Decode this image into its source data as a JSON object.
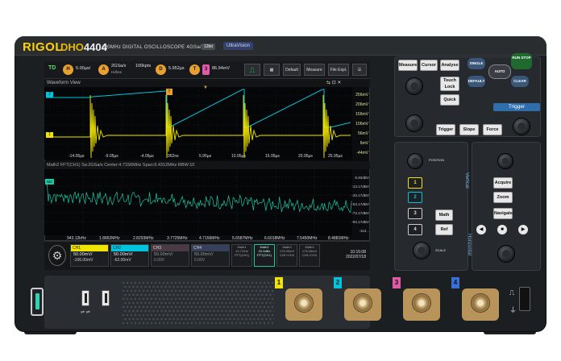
{
  "header": {
    "brand": "RIGOL",
    "model_prefix": "DHO",
    "model_number": "4404",
    "spec": "400MHz   DIGITAL OSCILLOSCOPE  4GSa/s",
    "bit_badge": "12bit",
    "ultra_badge": "UltraVision"
  },
  "statusbar": {
    "run_state": "TD",
    "h_label": "H",
    "h_value": "5.00µs/",
    "a_label": "A",
    "a_rate": "2GSa/s",
    "a_points": "100kpts",
    "d_label": "D",
    "d_value": "5.952µs",
    "t_label": "T",
    "t_channel": "3",
    "t_value": "86.94mV",
    "default_label": "Default",
    "measure_label": "Measure",
    "file_label": "File Expl."
  },
  "waveform": {
    "title": "Waveform View",
    "y_labels": [
      "256mV",
      "206mV",
      "156mV",
      "106mV",
      "56mV",
      "6mV",
      "-44mV"
    ],
    "x_labels": [
      "-14.05µs",
      "-9.05µs",
      "-4.05µs",
      "952ns",
      "5.95µs",
      "10.95µs",
      "15.95µs",
      "20.95µs",
      "25.95µs"
    ],
    "marker_ch1": "1",
    "marker_ch2": "2",
    "trigger_marker": "T"
  },
  "fft": {
    "title": "Math2   FFT(CH1)   Sa:2GSa/s    Center:4.7156MHz      Span:9.4312MHz     RBW:10",
    "y_labels": [
      "6.83dBV",
      "-13.17dBV",
      "-33.17dBV",
      "-53.17dBV",
      "-73.17dBV",
      "-93.17dBV",
      "-113..."
    ],
    "x_labels": [
      "943.12kHz",
      "1.8862MHz",
      "2.8293MHz",
      "3.7725MHz",
      "4.7156MHz",
      "5.6587MHz",
      "6.6018MHz",
      "7.5450MHz",
      "8.4881MHz"
    ],
    "marker": "M2"
  },
  "channels": [
    {
      "name": "CH1",
      "scale": "50.00mV/",
      "offset": "-106.00mV",
      "color": "#f1e400"
    },
    {
      "name": "CH2",
      "scale": "50.00mV/",
      "offset": "-62.00mV",
      "color": "#00c4dd"
    },
    {
      "name": "CH3",
      "scale": "50.00mV/",
      "offset": "0.00V",
      "color": "#e05aa8"
    },
    {
      "name": "CH4",
      "scale": "50.00mV/",
      "offset": "0.00V",
      "color": "#3a6fd8"
    }
  ],
  "math_slots": [
    {
      "name": "Math1",
      "value": "10.7GHz",
      "func": "FFT(CH1)"
    },
    {
      "name": "Math2",
      "value": "20.0dBz",
      "func": "FFT(CH1)"
    },
    {
      "name": "Math3",
      "value": "174.00mV",
      "func": "CH1+CH2"
    },
    {
      "name": "Math4",
      "value": "174.00mV",
      "func": "CH1+CH2"
    }
  ],
  "clock": {
    "time": "10:15:08",
    "date": "2022/07/18"
  },
  "panel": {
    "measure": "Measure",
    "cursor": "Cursor",
    "analyse": "Analyse",
    "single": "SINGLE",
    "run_stop": "RUN STOP",
    "auto": "AUTO",
    "default": "DEFAULT",
    "clear": "CLEAR",
    "touch_lock": "Touch Lock",
    "quick": "Quick",
    "trigger_section": "Trigger",
    "trigger": "Trigger",
    "slope": "Slope",
    "force": "Force",
    "vertical": "Vertical",
    "horizontal": "Horizontal",
    "position": "POSITION",
    "scale": "SCALE",
    "math": "Math",
    "ref": "Ref",
    "acquire": "Acquire",
    "zoom": "Zoom",
    "navigate": "Navigate",
    "ch_buttons": [
      "1",
      "2",
      "3",
      "4"
    ]
  },
  "front": {
    "bnc_numbers": [
      "1",
      "2",
      "3",
      "4"
    ]
  },
  "colors": {
    "ch1": "#f1e400",
    "ch2": "#00c4dd",
    "ch3": "#e05aa8",
    "ch4": "#3a6fd8",
    "fft": "#19c9a6",
    "accent": "#2f6eaa"
  }
}
